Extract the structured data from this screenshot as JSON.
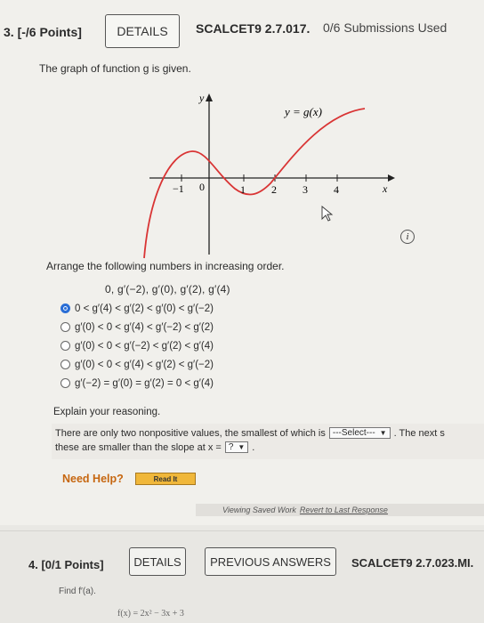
{
  "q3": {
    "points": "3. [-/6 Points]",
    "details_label": "DETAILS",
    "course_code": "SCALCET9 2.7.017.",
    "submissions": "0/6 Submissions Used",
    "prompt": "The graph of function g is given.",
    "graph": {
      "y_axis_label": "y",
      "x_axis_label": "x",
      "curve_label": "y = g(x)",
      "ticks": [
        "−1",
        "0",
        "1",
        "2",
        "3",
        "4"
      ],
      "curve_color": "#d93434"
    },
    "info_icon_glyph": "i",
    "arrange_text": "Arrange the following numbers in increasing order.",
    "numbers_text": "0,   g′(−2),   g′(0),   g′(2),   g′(4)",
    "options": [
      {
        "label": "0 < g′(4) < g′(2) < g′(0) < g′(−2)",
        "selected": true
      },
      {
        "label": "g′(0) < 0 < g′(4) < g′(−2) < g′(2)",
        "selected": false
      },
      {
        "label": "g′(0) < 0 < g′(−2) < g′(2) < g′(4)",
        "selected": false
      },
      {
        "label": "g′(0) < 0 < g′(4) < g′(2) < g′(−2)",
        "selected": false
      },
      {
        "label": "g′(−2) = g′(0) = g′(2) = 0 < g′(4)",
        "selected": false
      }
    ],
    "explain_label": "Explain your reasoning.",
    "reasoning": {
      "line1_before": "There are only two nonpositive values, the smallest of which is",
      "select1_value": "---Select---",
      "line1_after": ". The next s",
      "line2_before": "these are smaller than the slope at x =",
      "select2_value": "?",
      "line2_after": "."
    },
    "need_help": "Need Help?",
    "read_it": "Read It",
    "saved_text": "Viewing Saved Work",
    "revert_text": "Revert to Last Response"
  },
  "q4": {
    "points": "4. [0/1 Points]",
    "details_label": "DETAILS",
    "prev_answers_label": "PREVIOUS ANSWERS",
    "course_code": "SCALCET9 2.7.023.MI.",
    "find_text": "Find f′(a).",
    "formula_text": "f(x) = 2x² − 3x + 3"
  },
  "colors": {
    "accent_radio": "#2a6ed6",
    "need_help": "#c6660f",
    "read_it_bg": "#f0b73a"
  }
}
